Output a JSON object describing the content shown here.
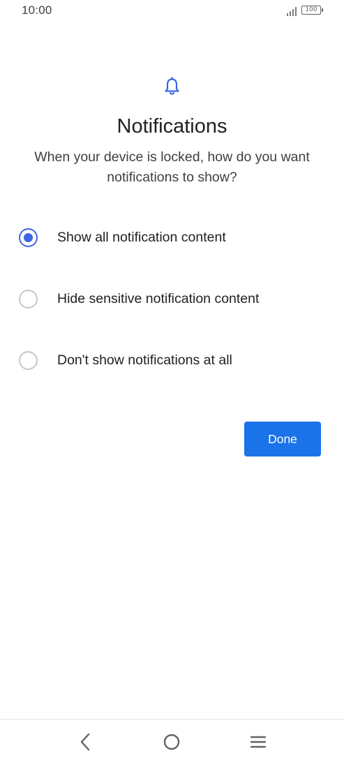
{
  "status_bar": {
    "time": "10:00",
    "battery": "100",
    "icons": [
      "signal-icon",
      "battery-icon"
    ]
  },
  "header": {
    "icon": "bell-icon",
    "title": "Notifications",
    "subtitle": "When your device is locked, how do you want notifications to show?"
  },
  "options": [
    {
      "label": "Show all notification content",
      "selected": true
    },
    {
      "label": "Hide sensitive notification content",
      "selected": false
    },
    {
      "label": "Don't show notifications at all",
      "selected": false
    }
  ],
  "actions": {
    "done_label": "Done"
  },
  "navigation": {
    "icons": [
      "back-icon",
      "home-icon",
      "menu-icon"
    ]
  },
  "colors": {
    "accent": "#1a73e8",
    "radio_selected": "#3c67e3",
    "radio_unselected": "#c7c7c7",
    "text_primary": "#202124",
    "text_secondary": "#3c4043"
  }
}
